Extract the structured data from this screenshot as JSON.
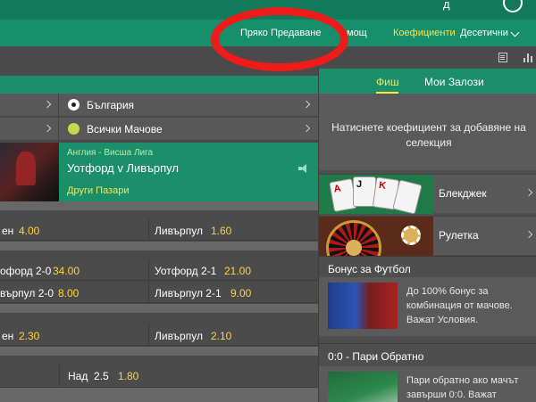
{
  "header": {
    "partial_text": "д",
    "nav": {
      "live": "Пряко Предаване",
      "help": "мощ",
      "odds_label": "Коефициенти",
      "odds_value": "Десетични"
    }
  },
  "filters": [
    {
      "label": "България",
      "icon": "soccer-ball-icon"
    },
    {
      "label": "Всички Мачове",
      "icon": "tennis-ball-icon"
    }
  ],
  "match": {
    "league": "Англия - Висша Лига",
    "teams": "Уотфорд v Ливърпул",
    "more": "Други Пазари"
  },
  "markets": {
    "row1": {
      "left_label": "ен",
      "left_odds": "4.00",
      "right_label": "Ливърпул",
      "right_odds": "1.60"
    },
    "row2": {
      "left_label": "офорд 2-0",
      "left_odds": "34.00",
      "right_label": "Уотфорд 2-1",
      "right_odds": "21.00"
    },
    "row3": {
      "left_label": "върпул 2-0",
      "left_odds": "8.00",
      "right_label": "Ливърпул 2-1",
      "right_odds": "9.00"
    },
    "row4": {
      "left_label": "ен",
      "left_odds": "2.30",
      "right_label": "Ливърпул",
      "right_odds": "2.10"
    },
    "row5": {
      "label": "Над",
      "line": "2.5",
      "odds": "1.80"
    }
  },
  "betslip": {
    "tab_slip": "Фиш",
    "tab_my_bets": "Мои Залози",
    "message": "Натиснете коефициент за добавяне на селекция"
  },
  "games": {
    "blackjack": "Блекджек",
    "roulette": "Рулетка",
    "card_a": "A",
    "card_j": "J",
    "card_k": "K"
  },
  "promos": {
    "football": {
      "title": "Бонус за Футбол",
      "text": "До 100% бонус за комбинация от мачове. Важат Условия."
    },
    "cashback": {
      "title": "0:0 - Пари Обратно",
      "text": "Пари обратно ако мачът завърши 0:0. Важат"
    }
  },
  "colors": {
    "brand_green": "#178f6b",
    "accent_yellow": "#ffe24a",
    "odds_yellow": "#ffd23a",
    "annotation_red": "#ee1b1b"
  }
}
